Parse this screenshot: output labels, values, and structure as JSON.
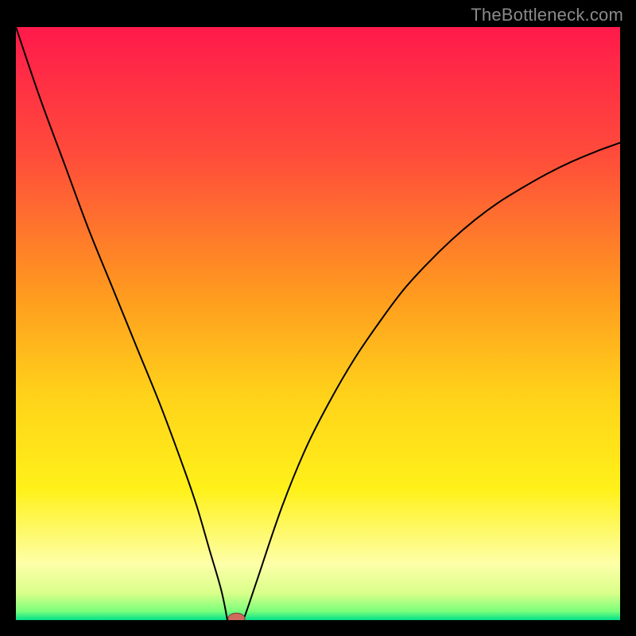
{
  "watermark": "TheBottleneck.com",
  "colors": {
    "frame": "#000000",
    "watermark": "#8a8a8a",
    "curve": "#000000",
    "marker_fill": "#cf6b5e",
    "marker_stroke": "#7d3b33",
    "gradient_stops": [
      {
        "offset": 0.0,
        "color": "#ff1a4b"
      },
      {
        "offset": 0.22,
        "color": "#ff4d3a"
      },
      {
        "offset": 0.45,
        "color": "#ff9a1f"
      },
      {
        "offset": 0.62,
        "color": "#ffd21a"
      },
      {
        "offset": 0.78,
        "color": "#fff11a"
      },
      {
        "offset": 0.905,
        "color": "#feffa8"
      },
      {
        "offset": 0.955,
        "color": "#d8ff8a"
      },
      {
        "offset": 0.985,
        "color": "#7bff7b"
      },
      {
        "offset": 1.0,
        "color": "#00e08a"
      }
    ]
  },
  "chart_data": {
    "type": "line",
    "title": "",
    "xlabel": "",
    "ylabel": "",
    "xlim": [
      0,
      100
    ],
    "ylim": [
      0,
      100
    ],
    "grid": false,
    "legend": null,
    "series": [
      {
        "name": "bottleneck-curve",
        "x": [
          0,
          4,
          8,
          12,
          16,
          20,
          24,
          28,
          30,
          32,
          34,
          35,
          36,
          37,
          38,
          40,
          44,
          48,
          52,
          56,
          60,
          64,
          68,
          72,
          76,
          80,
          84,
          88,
          92,
          96,
          100
        ],
        "y": [
          100,
          88,
          77,
          66,
          56,
          46,
          36,
          25,
          19,
          12,
          5,
          1,
          0,
          0,
          1,
          7,
          19,
          29,
          37,
          44,
          50,
          55.5,
          60,
          64,
          67.5,
          70.5,
          73,
          75.3,
          77.3,
          79,
          80.5
        ]
      }
    ],
    "marker": {
      "x": 36.5,
      "y": 0,
      "rx": 1.4,
      "ry": 0.9
    },
    "flat_bottom": {
      "x0": 35,
      "x1": 37.5,
      "y": 0
    }
  }
}
